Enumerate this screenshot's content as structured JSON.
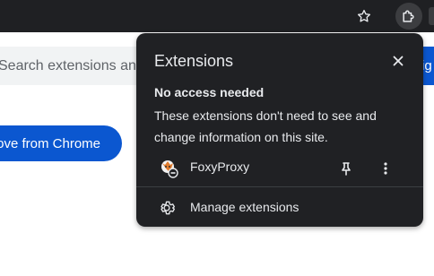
{
  "background_page": {
    "search_placeholder": "Search extensions an",
    "right_button_fragment": "ig",
    "remove_button_label": "ove from Chrome"
  },
  "toolbar": {
    "star_icon": "star-outline",
    "extensions_icon": "puzzle-piece"
  },
  "popup": {
    "title": "Extensions",
    "close_icon": "close",
    "section": {
      "heading": "No access needed",
      "description": "These extensions don't need to see and change information on this site."
    },
    "extensions": [
      {
        "name": "FoxyProxy",
        "icon": "foxyproxy-logo",
        "pin_icon": "pin",
        "menu_icon": "more-vertical"
      }
    ],
    "manage_label": "Manage extensions",
    "manage_icon": "gear"
  },
  "colors": {
    "popup_bg": "#202124",
    "toolbar_bg": "#1f2023",
    "primary_blue": "#0b57d0",
    "text_light": "#e8eaed"
  }
}
